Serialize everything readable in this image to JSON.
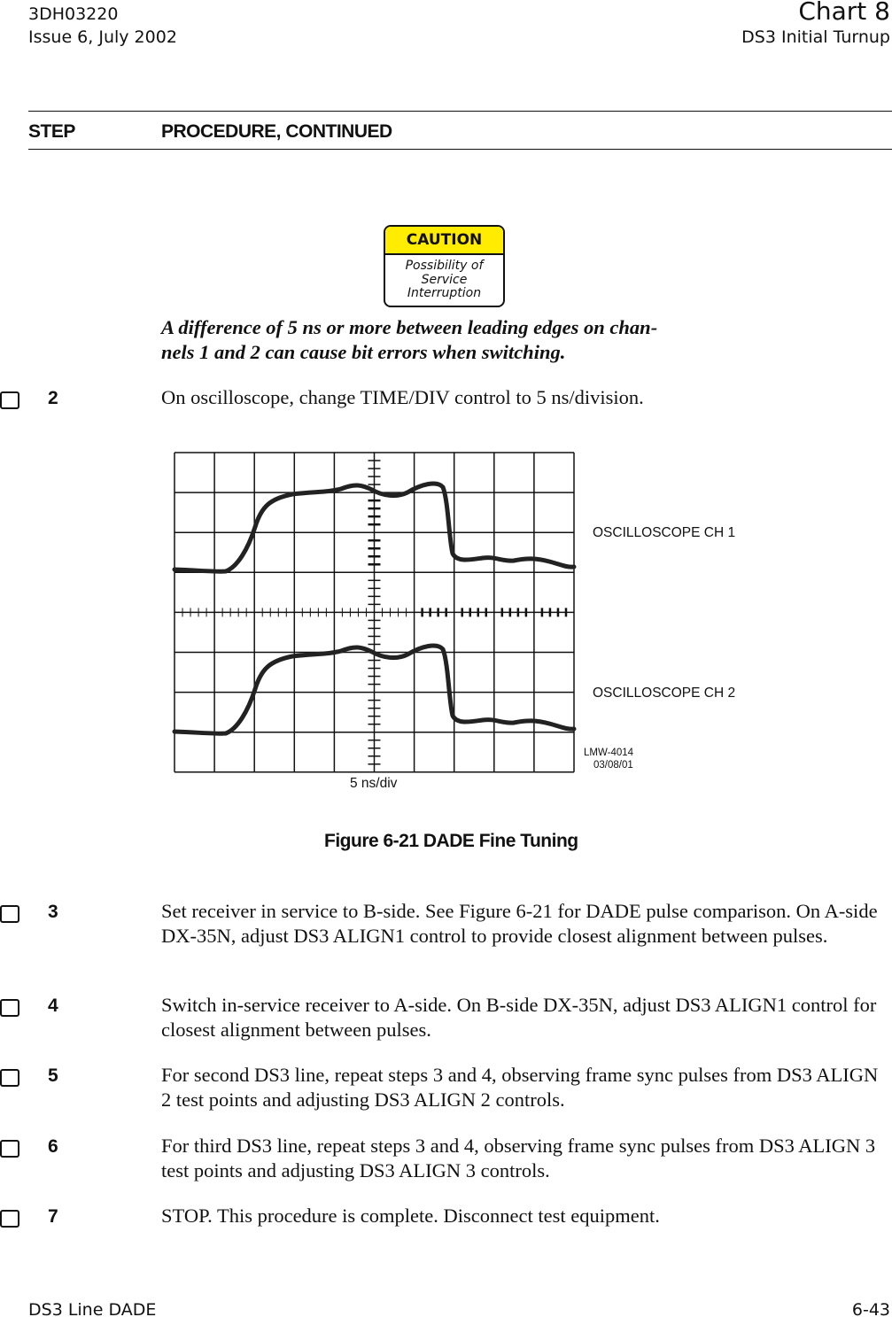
{
  "header": {
    "doc_id": "3DH03220",
    "issue": "Issue 6, July 2002",
    "chart": "Chart 8",
    "chart_title": "DS3 Initial Turnup"
  },
  "columns": {
    "step": "STEP",
    "procedure": "PROCEDURE, CONTINUED"
  },
  "caution": {
    "title": "CAUTION",
    "line1": "Possibility of",
    "line2": "Service",
    "line3": "Interruption",
    "color": "#ffec00"
  },
  "warning_text": "A difference of 5 ns or more between leading edges on channels 1 and 2 can cause bit errors when switching.",
  "warning_line1": "A difference of 5 ns or more between leading edges on chan-",
  "warning_line2": "nels 1 and 2 can cause bit errors when switching.",
  "steps": [
    {
      "number": "2",
      "text": "On oscilloscope, change TIME/DIV control to 5 ns/division."
    },
    {
      "number": "3",
      "text": "Set receiver in service to B-side. See Figure 6-21 for DADE pulse comparison. On A-side DX-35N, adjust DS3 ALIGN1 control to provide closest alignment between pulses."
    },
    {
      "number": "4",
      "text": "Switch in-service receiver to A-side. On B-side DX-35N, adjust DS3 ALIGN1 control for closest alignment between pulses."
    },
    {
      "number": "5",
      "text": "For second DS3 line, repeat steps 3 and 4, observing frame sync pulses from DS3 ALIGN 2 test points and adjusting DS3 ALIGN 2 controls."
    },
    {
      "number": "6",
      "text": "For third DS3 line, repeat steps 3 and 4, observing frame sync pulses from DS3 ALIGN 3 test points and adjusting DS3 ALIGN 3 controls."
    },
    {
      "number": "7",
      "text": "STOP. This procedure is complete. Disconnect test equipment."
    }
  ],
  "figure": {
    "ch1_label": "OSCILLOSCOPE CH 1",
    "ch2_label": "OSCILLOSCOPE CH 2",
    "timebase": "5 ns/div",
    "drawing_id": "LMW-4014",
    "drawing_date": "03/08/01",
    "caption": "Figure 6-21  DADE Fine Tuning"
  },
  "footer": {
    "section": "DS3 Line DADE",
    "page": "6-43"
  }
}
